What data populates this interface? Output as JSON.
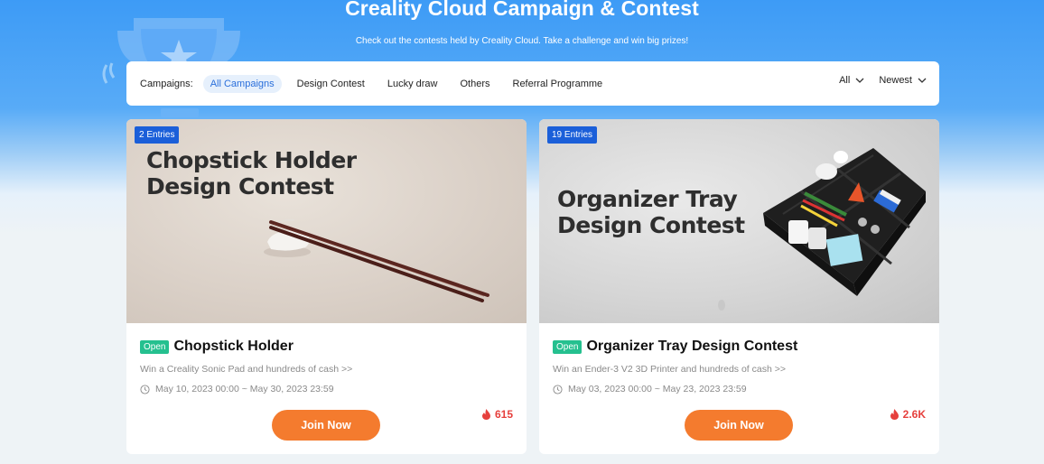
{
  "hero": {
    "title": "Creality Cloud Campaign & Contest",
    "subtitle": "Check out the contests held by Creality Cloud. Take a challenge and win big prizes!"
  },
  "filters": {
    "label": "Campaigns:",
    "categories": [
      "All Campaigns",
      "Design Contest",
      "Lucky draw",
      "Others",
      "Referral Programme"
    ],
    "active_category": "All Campaigns",
    "status_select": "All",
    "sort_select": "Newest"
  },
  "cards": [
    {
      "entries": "2 Entries",
      "image_text_line1": "Chopstick Holder",
      "image_text_line2": "Design Contest",
      "status": "Open",
      "title": "Chopstick Holder",
      "description": "Win a Creality Sonic Pad and hundreds of cash >>",
      "dates": "May 10, 2023 00:00 ~ May 30, 2023 23:59",
      "popularity": "615",
      "button": "Join Now"
    },
    {
      "entries": "19 Entries",
      "image_text_line1": "Organizer Tray",
      "image_text_line2": "Design Contest",
      "status": "Open",
      "title": "Organizer Tray Design Contest",
      "description": "Win an Ender-3 V2 3D Printer and hundreds of cash >>",
      "dates": "May 03, 2023 00:00 ~ May 23, 2023 23:59",
      "popularity": "2.6K",
      "button": "Join Now"
    }
  ],
  "icons": {
    "trophy": "trophy-icon",
    "chevron": "chevron-down-icon",
    "clock": "clock-icon",
    "fire": "fire-icon"
  },
  "colors": {
    "accent": "#f47b2e",
    "primary": "#1b5fd9",
    "open_badge": "#25c08f",
    "hot": "#e6403d"
  }
}
